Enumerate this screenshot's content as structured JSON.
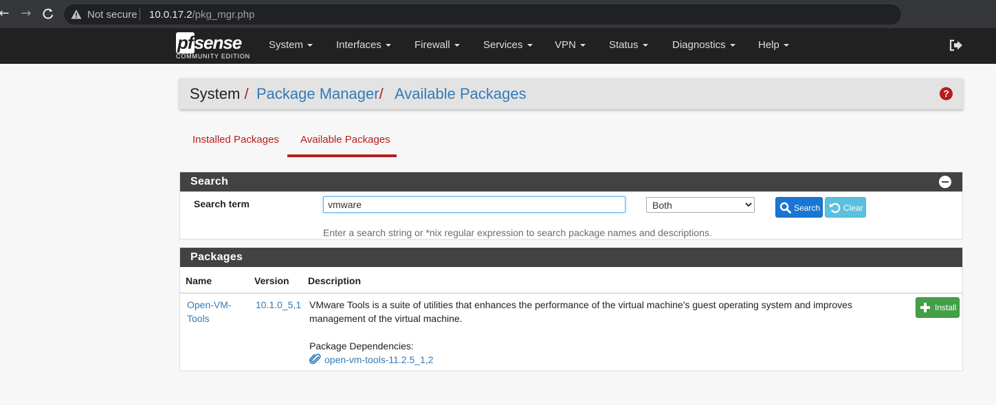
{
  "browser": {
    "security_label": "Not secure",
    "url_host": "10.0.17.2",
    "url_path": "/pkg_mgr.php"
  },
  "navbar": {
    "logo_pf": "pf",
    "logo_sense": "sense",
    "logo_edition": "COMMUNITY EDITION",
    "menus": [
      "System",
      "Interfaces",
      "Firewall",
      "Services",
      "VPN",
      "Status",
      "Diagnostics",
      "Help"
    ]
  },
  "breadcrumb": {
    "root": "System",
    "sep": "/",
    "level1": "Package Manager",
    "level2": "Available Packages",
    "help": "?"
  },
  "tabs": [
    {
      "label": "Installed Packages",
      "active": false
    },
    {
      "label": "Available Packages",
      "active": true
    }
  ],
  "search_panel": {
    "title": "Search",
    "term_label": "Search term",
    "term_value": "vmware",
    "scope_selected": "Both",
    "search_button": "Search",
    "clear_button": "Clear",
    "help_text": "Enter a search string or *nix regular expression to search package names and descriptions."
  },
  "packages_panel": {
    "title": "Packages",
    "columns": [
      "Name",
      "Version",
      "Description"
    ],
    "rows": [
      {
        "name_line1": "Open-VM-",
        "name_line2": "Tools",
        "version": "10.1.0_5,1",
        "description_line1": "VMware Tools is a suite of utilities that enhances the performance of the virtual machine's guest operating system and improves",
        "description_line2": "management of the virtual machine.",
        "deps_label": "Package Dependencies:",
        "dependency": "open-vm-tools-11.2.5_1,2",
        "action": "Install"
      }
    ]
  },
  "colors": {
    "navbar_bg": "#212121",
    "accent_red": "#b71c1c",
    "link_blue": "#337ab7",
    "panel_head": "#424242",
    "install_green": "#43a047",
    "search_blue": "#1976d2",
    "clear_cyan": "#5bc0de"
  }
}
